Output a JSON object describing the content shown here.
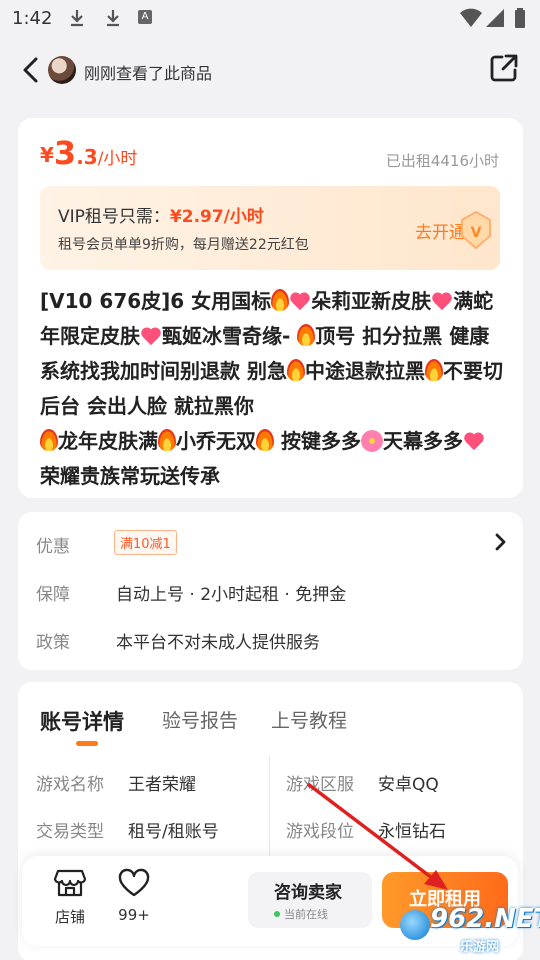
{
  "status_bar": {
    "time": "1:42",
    "a_badge": "A"
  },
  "nav": {
    "viewed_text": "刚刚查看了此商品"
  },
  "product": {
    "price_symbol": "¥",
    "price_int": "3",
    "price_dec": ".3",
    "price_unit": "/小时",
    "rented": "已出租4416小时",
    "vip": {
      "label": "VIP租号只需：",
      "price": "¥2.97/小时",
      "desc": "租号会员单单9折购，每月赠送22元红包",
      "open": "去开通"
    },
    "title_parts": {
      "p1": "[V10 676皮]6 女用国标",
      "p2": "朵莉亚新皮肤",
      "p3": "满蛇年限定皮肤",
      "p4": "甄姬冰雪奇缘- ",
      "p5": "顶号 扣分拉黑 健康系统找我加时间别退款 别急",
      "p6": "中途退款拉黑",
      "p7": "不要切后台 会出人脸 就拉黑你",
      "p8": "龙年皮肤满",
      "p9": "小乔无双",
      "p10": " 按键多多",
      "p11": "天幕多多",
      "p12": " 荣耀贵族常玩送传承"
    }
  },
  "info": {
    "discount_label": "优惠",
    "discount_coupon": "满10减1",
    "guarantee_label": "保障",
    "guarantee_value": "自动上号 · 2小时起租 · 免押金",
    "policy_label": "政策",
    "policy_value": "本平台不对未成人提供服务"
  },
  "details": {
    "tabs": [
      "账号详情",
      "验号报告",
      "上号教程"
    ],
    "fields": {
      "game_name_k": "游戏名称",
      "game_name_v": "王者荣耀",
      "server_k": "游戏区服",
      "server_v": "安卓QQ",
      "trade_type_k": "交易类型",
      "trade_type_v": "租号/租账号",
      "rank_k": "游戏段位",
      "rank_v": "永恒钻石"
    }
  },
  "bottom": {
    "store": "店铺",
    "likes": "99+",
    "consult": "咨询卖家",
    "online": "当前在线",
    "rent_now": "立即租用"
  },
  "watermark": {
    "brand": "962.NET",
    "sub": "乐游网"
  },
  "colors": {
    "accent": "#ff7a1a",
    "price": "#ff4a1f",
    "arrow": "#e02020"
  }
}
